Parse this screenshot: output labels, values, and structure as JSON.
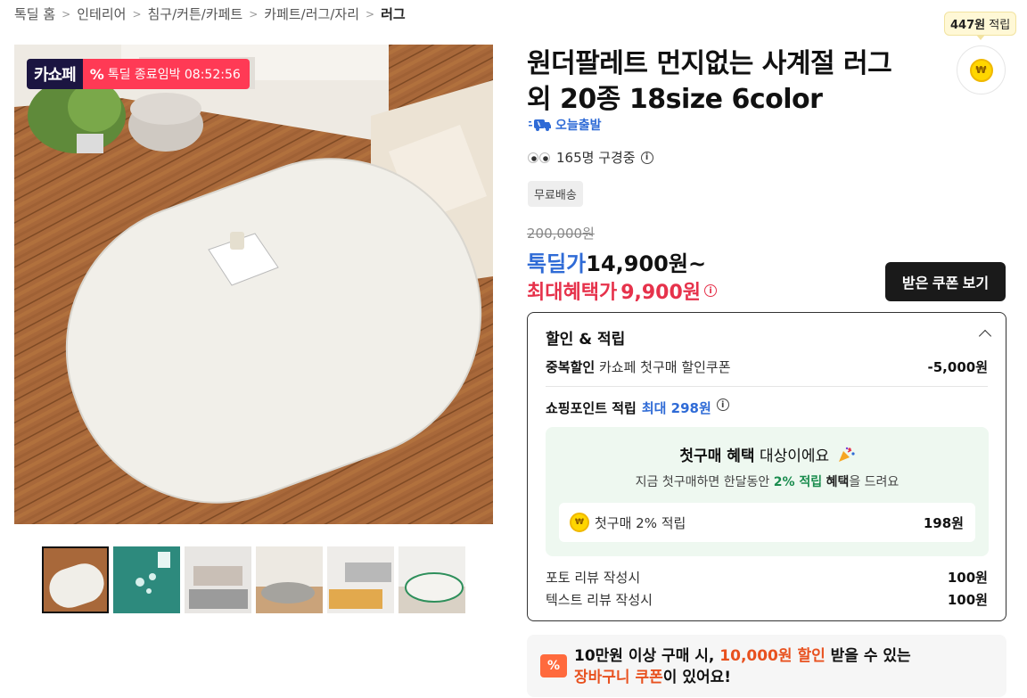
{
  "breadcrumb": {
    "items": [
      "톡딜 홈",
      "인테리어",
      "침구/커튼/카페트",
      "카페트/러그/자리",
      "러그"
    ],
    "separator": ">"
  },
  "main_image": {
    "badge_logo": "카쇼페",
    "badge_deal_icon": "%",
    "badge_deal_text": "톡딜 종료임박 08:52:56"
  },
  "thumbnails": {
    "count": 6,
    "selected_index": 0
  },
  "product": {
    "title": "원더팔레트 먼지없는 사계절 러그 외 20종 18size 6color",
    "delivery_label": "오늘출발",
    "viewers_text": "165명 구경중",
    "info_icon": "i",
    "free_shipping": "무료배송",
    "original_price": "200,000원",
    "deal_label": "톡딜가",
    "deal_price": "14,900원~",
    "max_benefit_label": "최대혜택가",
    "max_benefit_price": "9,900원"
  },
  "points": {
    "tag_amount": "447원",
    "tag_suffix": "적립",
    "coin_symbol": "₩"
  },
  "coupon_button": "받은 쿠폰 보기",
  "discount_panel": {
    "header": "할인 & 적립",
    "rows": [
      {
        "label": "중복할인",
        "desc": "카쇼페 첫구매 할인쿠폰",
        "amount": "-5,000원"
      }
    ],
    "shopping_points": {
      "label": "쇼핑포인트 적립",
      "max_label": "최대 298원"
    },
    "first_purchase": {
      "title_bold": "첫구매 혜택",
      "title_rest": "대상이에요",
      "sub_pre": "지금 첫구매하면 한달동안",
      "sub_pct": "2% 적립",
      "sub_bold": "혜택",
      "sub_post": "을 드려요",
      "row_label": "첫구매 2% 적립",
      "row_amount": "198원"
    },
    "review_rows": [
      {
        "label": "포토 리뷰 작성시",
        "amount": "100원"
      },
      {
        "label": "텍스트 리뷰 작성시",
        "amount": "100원"
      }
    ]
  },
  "cart_banner": {
    "icon": "%",
    "line1_pre": "10만원 이상 구매 시,",
    "line1_highlight": "10,000원 할인",
    "line1_post": "받을 수 있는",
    "line2_highlight": "장바구니 쿠폰",
    "line2_post": "이 있어요!"
  },
  "colors": {
    "deal_blue": "#2f6bd6",
    "benefit_red": "#e6324b",
    "badge_pink": "#ff3a55",
    "orange": "#e8511f",
    "first_box_bg": "#eef8f0"
  }
}
